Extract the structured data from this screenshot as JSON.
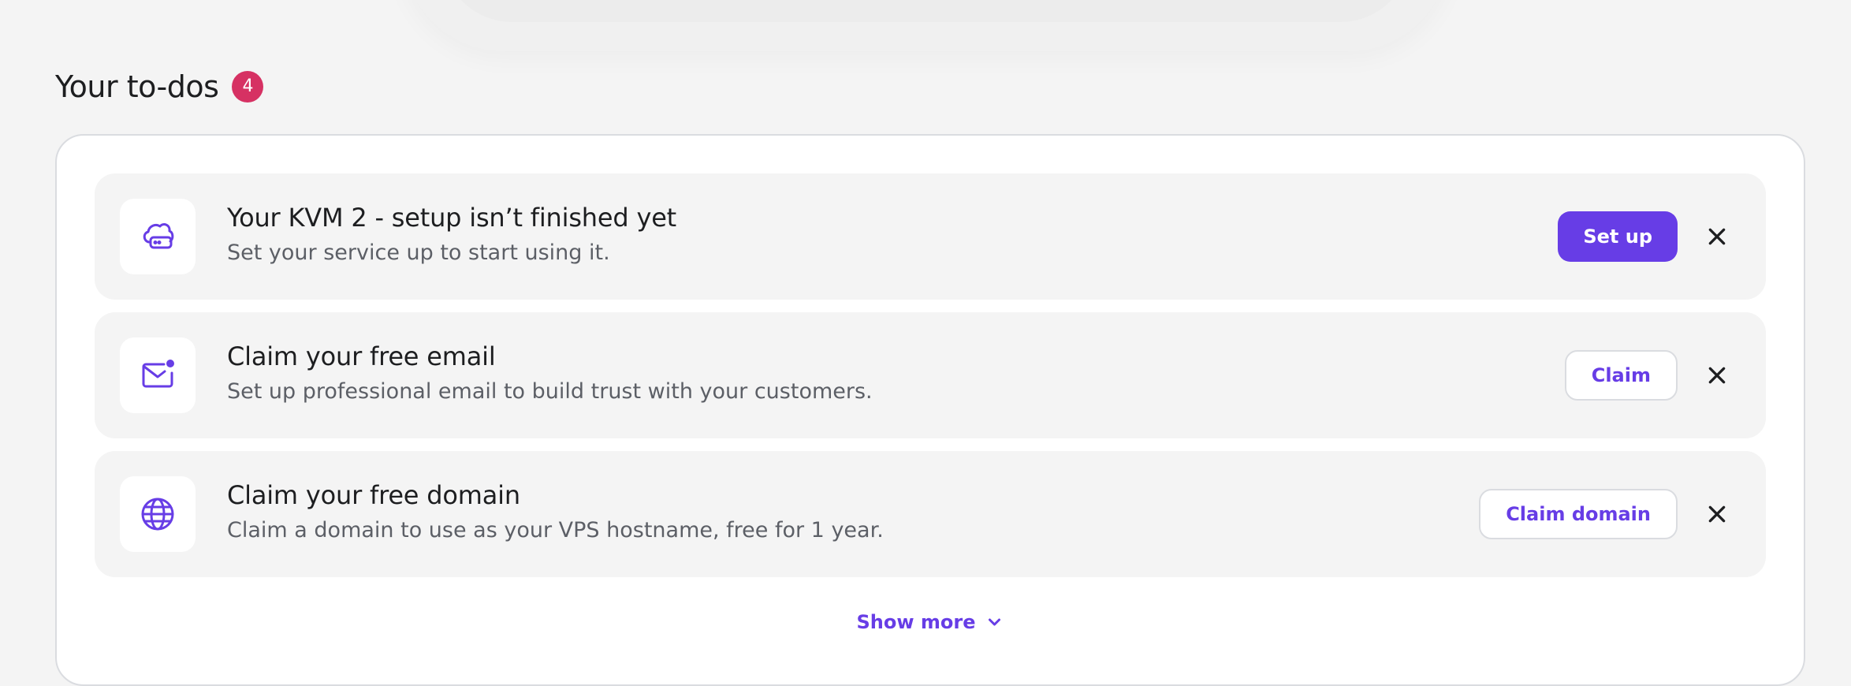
{
  "section": {
    "title": "Your to-dos",
    "count": "4"
  },
  "todos": [
    {
      "title": "Your KVM 2 - setup isn’t finished yet",
      "description": "Set your service up to start using it.",
      "action": "Set up",
      "icon": "cloud-server-icon"
    },
    {
      "title": "Claim your free email",
      "description": "Set up professional email to build trust with your customers.",
      "action": "Claim",
      "icon": "mail-icon"
    },
    {
      "title": "Claim your free domain",
      "description": "Claim a domain to use as your VPS hostname, free for 1 year.",
      "action": "Claim domain",
      "icon": "globe-icon"
    }
  ],
  "show_more": "Show more",
  "colors": {
    "accent": "#673de6",
    "badge": "#d63163",
    "row_bg": "#f4f4f4",
    "page_bg": "#f4f4f4"
  }
}
